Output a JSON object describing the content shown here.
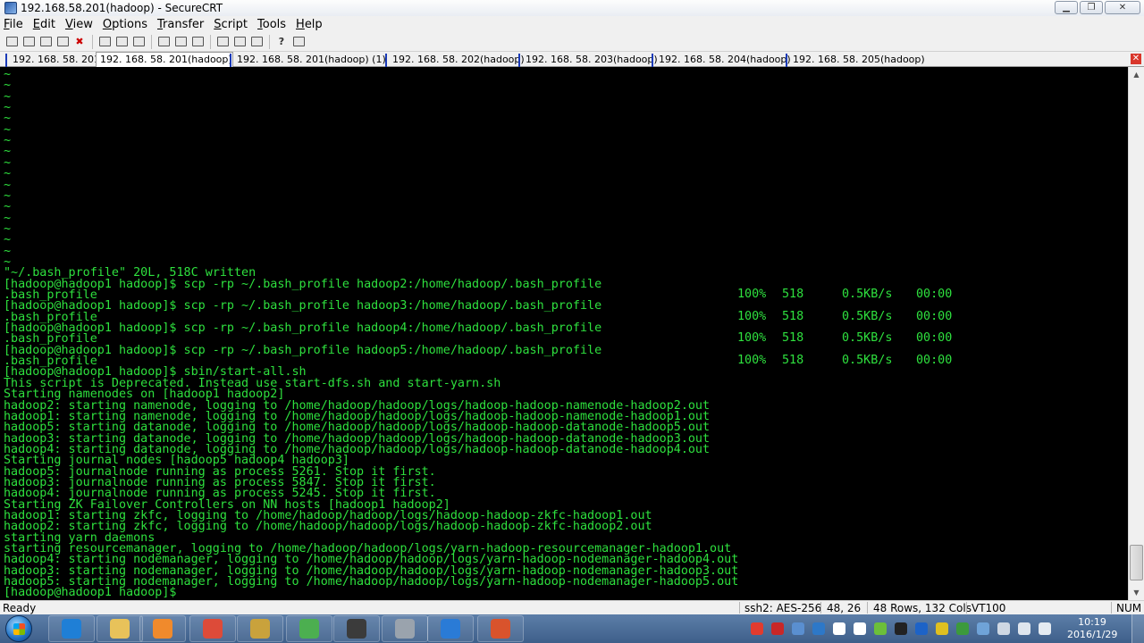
{
  "window": {
    "title": "192.168.58.201(hadoop) - SecureCRT",
    "minimize_glyph": "▁",
    "maximize_glyph": "❐",
    "close_glyph": "✕"
  },
  "menu": [
    "File",
    "Edit",
    "View",
    "Options",
    "Transfer",
    "Script",
    "Tools",
    "Help"
  ],
  "menu_mnemonics": [
    "F",
    "E",
    "V",
    "O",
    "T",
    "S",
    "T",
    "H"
  ],
  "toolbar": {
    "icons": [
      "connect-icon",
      "quick-connect-icon",
      "connect-tab-icon",
      "reconnect-icon",
      "disconnect-icon",
      "copy-icon",
      "paste-icon",
      "find-icon",
      "print-setup-icon",
      "print-icon",
      "print-screen-icon",
      "session-options-icon",
      "global-options-icon",
      "keymap-icon",
      "help-icon",
      "log-icon"
    ],
    "help_glyph": "?",
    "disconnect_glyph": "✖"
  },
  "tabs": [
    {
      "label": "192. 168. 58. 201",
      "active": false
    },
    {
      "label": "192. 168. 58. 201(hadoop)",
      "active": true
    },
    {
      "label": "192. 168. 58. 201(hadoop)  (1)",
      "active": false
    },
    {
      "label": "192. 168. 58. 202(hadoop)",
      "active": false
    },
    {
      "label": "192. 168. 58. 203(hadoop)",
      "active": false
    },
    {
      "label": "192. 168. 58. 204(hadoop)",
      "active": false
    },
    {
      "label": "192. 168. 58. 205(hadoop)",
      "active": false
    }
  ],
  "tab_close_glyph": "✕",
  "terminal": {
    "lines": [
      "~",
      "~",
      "~",
      "~",
      "~",
      "~",
      "~",
      "~",
      "~",
      "~",
      "~",
      "~",
      "~",
      "~",
      "~",
      "~",
      "~",
      "~",
      "\"~/.bash_profile\" 20L, 518C written",
      "[hadoop@hadoop1 hadoop]$ scp -rp ~/.bash_profile hadoop2:/home/hadoop/.bash_profile",
      ".bash_profile",
      "[hadoop@hadoop1 hadoop]$ scp -rp ~/.bash_profile hadoop3:/home/hadoop/.bash_profile",
      ".bash_profile",
      "[hadoop@hadoop1 hadoop]$ scp -rp ~/.bash_profile hadoop4:/home/hadoop/.bash_profile",
      ".bash_profile",
      "[hadoop@hadoop1 hadoop]$ scp -rp ~/.bash_profile hadoop5:/home/hadoop/.bash_profile",
      ".bash_profile",
      "[hadoop@hadoop1 hadoop]$ sbin/start-all.sh",
      "This script is Deprecated. Instead use start-dfs.sh and start-yarn.sh",
      "Starting namenodes on [hadoop1 hadoop2]",
      "hadoop2: starting namenode, logging to /home/hadoop/hadoop/logs/hadoop-hadoop-namenode-hadoop2.out",
      "hadoop1: starting namenode, logging to /home/hadoop/hadoop/logs/hadoop-hadoop-namenode-hadoop1.out",
      "hadoop5: starting datanode, logging to /home/hadoop/hadoop/logs/hadoop-hadoop-datanode-hadoop5.out",
      "hadoop3: starting datanode, logging to /home/hadoop/hadoop/logs/hadoop-hadoop-datanode-hadoop3.out",
      "hadoop4: starting datanode, logging to /home/hadoop/hadoop/logs/hadoop-hadoop-datanode-hadoop4.out",
      "Starting journal nodes [hadoop5 hadoop4 hadoop3]",
      "hadoop5: journalnode running as process 5261. Stop it first.",
      "hadoop3: journalnode running as process 5847. Stop it first.",
      "hadoop4: journalnode running as process 5245. Stop it first.",
      "Starting ZK Failover Controllers on NN hosts [hadoop1 hadoop2]",
      "hadoop1: starting zkfc, logging to /home/hadoop/hadoop/logs/hadoop-hadoop-zkfc-hadoop1.out",
      "hadoop2: starting zkfc, logging to /home/hadoop/hadoop/logs/hadoop-hadoop-zkfc-hadoop2.out",
      "starting yarn daemons",
      "starting resourcemanager, logging to /home/hadoop/hadoop/logs/yarn-hadoop-resourcemanager-hadoop1.out",
      "hadoop4: starting nodemanager, logging to /home/hadoop/hadoop/logs/yarn-hadoop-nodemanager-hadoop4.out",
      "hadoop3: starting nodemanager, logging to /home/hadoop/hadoop/logs/yarn-hadoop-nodemanager-hadoop3.out",
      "hadoop5: starting nodemanager, logging to /home/hadoop/hadoop/logs/yarn-hadoop-nodemanager-hadoop5.out",
      "[hadoop@hadoop1 hadoop]$"
    ],
    "transfers": [
      {
        "line": 20,
        "percent": "100%",
        "size": "518",
        "rate": "0.5KB/s",
        "time": "00:00"
      },
      {
        "line": 22,
        "percent": "100%",
        "size": "518",
        "rate": "0.5KB/s",
        "time": "00:00"
      },
      {
        "line": 24,
        "percent": "100%",
        "size": "518",
        "rate": "0.5KB/s",
        "time": "00:00"
      },
      {
        "line": 26,
        "percent": "100%",
        "size": "518",
        "rate": "0.5KB/s",
        "time": "00:00"
      }
    ],
    "text_color": "#2ee03e",
    "background": "#000000"
  },
  "scrollbar": {
    "up_glyph": "▲",
    "down_glyph": "▼"
  },
  "status": {
    "ready": "Ready",
    "protocol": "ssh2: AES-256",
    "cursor": "48,  26",
    "size": "48 Rows, 132 Cols",
    "emulation": "VT100",
    "num": "NUM"
  },
  "taskbar": {
    "apps": [
      {
        "name": "internet-explorer-icon",
        "color": "#1f7fd6"
      },
      {
        "name": "file-explorer-icon",
        "color": "#e8c25a"
      },
      {
        "name": "media-player-icon",
        "color": "#f08a2c"
      },
      {
        "name": "chrome-icon",
        "color": "#dd4b39"
      },
      {
        "name": "network-tool-icon",
        "color": "#c9a23c"
      },
      {
        "name": "refresh-app-icon",
        "color": "#4caf50"
      },
      {
        "name": "lock-app-icon",
        "color": "#3b3b3b"
      },
      {
        "name": "terminal-app-icon",
        "color": "#9aa3ad"
      },
      {
        "name": "securecrt-app-icon",
        "color": "#2a7bd6"
      },
      {
        "name": "game-app-icon",
        "color": "#d9532c"
      }
    ],
    "tray": [
      {
        "name": "input-method-icon",
        "color": "#e23b2e"
      },
      {
        "name": "antivirus-icon",
        "color": "#c92727"
      },
      {
        "name": "network-share-icon",
        "color": "#5a8fd0"
      },
      {
        "name": "update-icon",
        "color": "#2d78c8"
      },
      {
        "name": "windows-flag-icon",
        "color": "#ffffff"
      },
      {
        "name": "camera-icon",
        "color": "#ffffff"
      },
      {
        "name": "ball-icon",
        "color": "#6cbf3a"
      },
      {
        "name": "qq-icon",
        "color": "#222222"
      },
      {
        "name": "bluetooth-icon",
        "color": "#1d63c7"
      },
      {
        "name": "plus-icon",
        "color": "#e0c020"
      },
      {
        "name": "shield-icon",
        "color": "#3c9a3c"
      },
      {
        "name": "monitor-icon",
        "color": "#6fa3d8"
      },
      {
        "name": "flag-icon",
        "color": "#cfd8e3"
      },
      {
        "name": "speaker-icon",
        "color": "#dfe6ee"
      },
      {
        "name": "signal-icon",
        "color": "#e4ebf2"
      }
    ],
    "clock_time": "10:19",
    "clock_date": "2016/1/29"
  }
}
